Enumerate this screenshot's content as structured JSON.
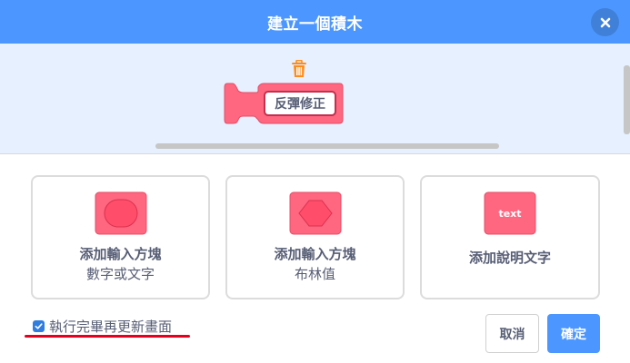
{
  "dialog": {
    "title": "建立一個積木",
    "close_icon": "close-icon"
  },
  "preview": {
    "block_label": "反彈修正",
    "block_color": "#ff6680",
    "trash_icon": "trash-icon",
    "trash_color": "#ff8c1a"
  },
  "options": [
    {
      "line1": "添加輸入方塊",
      "line2": "數字或文字",
      "icon": "round-input-icon"
    },
    {
      "line1": "添加輸入方塊",
      "line2": "布林值",
      "icon": "boolean-input-icon"
    },
    {
      "line1": "添加說明文字",
      "icon": "label-text-icon",
      "icon_text": "text"
    }
  ],
  "footer": {
    "checkbox_label": "執行完畢再更新畫面",
    "checkbox_checked": true,
    "cancel_label": "取消",
    "ok_label": "確定"
  },
  "colors": {
    "header": "#4c97ff",
    "workspace": "#e6f0ff",
    "block": "#ff6680",
    "annotation": "#e6001e"
  }
}
